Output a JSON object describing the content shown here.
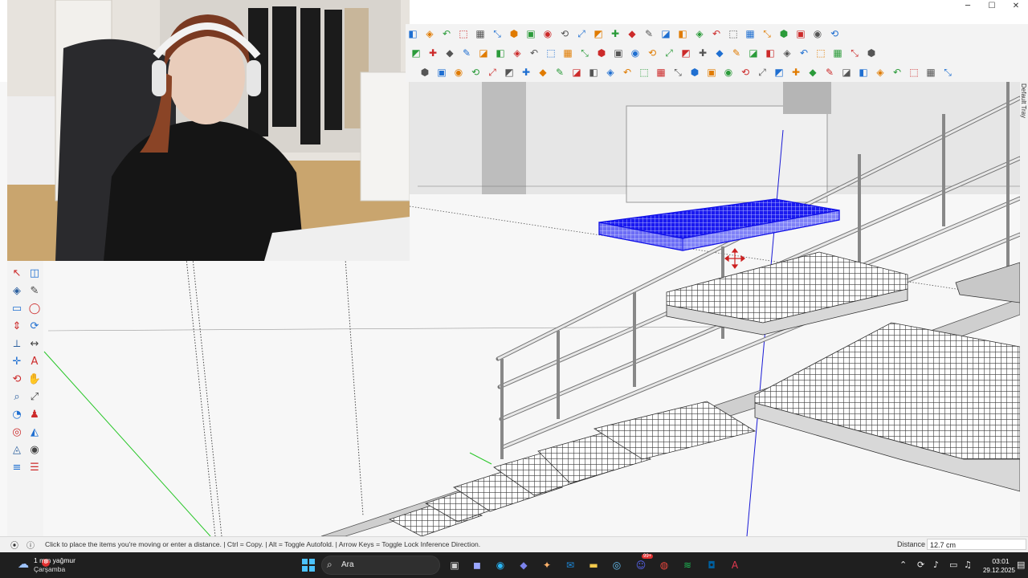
{
  "window": {
    "controls": [
      {
        "name": "minimize-button",
        "glyph": "─"
      },
      {
        "name": "maximize-button",
        "glyph": "☐"
      },
      {
        "name": "close-button",
        "glyph": "✕"
      }
    ]
  },
  "toolbar_rows": [
    {
      "name": "toolbar-row-views",
      "icons": [
        "walk-icon",
        "styles-icon",
        "orbit-icon",
        "new-icon",
        "user-icon",
        "xray-icon",
        "section-icon",
        "back-edges-icon",
        "wireframe-icon",
        "hidden-line-icon",
        "shaded-icon",
        "textured-icon",
        "monochrome-icon",
        "iso-icon",
        "top-view-icon",
        "front-view-icon",
        "right-view-icon",
        "back-view-icon",
        "left-view-icon",
        "camera-icon",
        "layers-icon",
        "shadow-icon",
        "fog-icon",
        "page-icon",
        "cube-icon",
        "house-icon"
      ]
    },
    {
      "name": "toolbar-row-tools",
      "icons": [
        "warning-icon",
        "rotate-icon",
        "extension-icon",
        "gear-icon",
        "move-icon",
        "bucket-icon",
        "undo-icon",
        "component-icon",
        "solid-icon",
        "group-icon",
        "paint-icon",
        "explode-icon",
        "array-icon",
        "grid-icon",
        "table-icon",
        "panel-icon",
        "box-icon",
        "wall-icon",
        "hatch-icon",
        "snap-icon",
        "circle-dash-icon",
        "scale-icon",
        "split-icon",
        "fold-icon",
        "stretch-icon",
        "trim-icon",
        "flip-icon",
        "mirror-icon"
      ]
    },
    {
      "name": "toolbar-row-curves",
      "icons": [
        "bezier-icon",
        "spline-icon",
        "pen-icon",
        "curve-icon",
        "freehand-icon",
        "arc-icon",
        "rect-icon",
        "polygon-icon",
        "circle-icon",
        "bend-icon",
        "zigzag-icon",
        "offset-icon",
        "fillet-icon",
        "chamfer-icon",
        "weld-icon",
        "node-icon",
        "edge-icon",
        "wrench-icon",
        "ellipse-icon",
        "cone-icon",
        "align-icon",
        "distribute-icon",
        "stack-icon",
        "copy-icon",
        "array2-icon",
        "path-icon",
        "loft-icon",
        "sweep-icon",
        "extrude-icon",
        "join-icon",
        "cut-icon",
        "project-icon"
      ]
    }
  ],
  "toolbar_colors": {
    "blue": "#1f6fd1",
    "orange": "#e07b00",
    "green": "#2b9b3a",
    "red": "#cc2a2a",
    "gray": "#555555"
  },
  "left_tools": [
    "select-icon",
    "eraser-icon",
    "paint-bucket-icon",
    "pencil-icon",
    "rectangle-icon",
    "circle-icon",
    "push-pull-icon",
    "follow-me-icon",
    "tape-measure-icon",
    "dimension-icon",
    "axes-icon",
    "text-icon",
    "orbit-icon",
    "pan-icon",
    "zoom-icon",
    "zoom-extents-icon",
    "look-around-icon",
    "walk-icon",
    "position-camera-icon",
    "section-plane-icon",
    "sandbox-icon",
    "stamp-icon",
    "layers-icon",
    "outliner-icon"
  ],
  "tray": {
    "label": "Default Tray"
  },
  "status": {
    "message": "Click to place the items you're moving or enter a distance.  |  Ctrl = Copy.  |  Alt = Toggle Autofold.  |  Arrow Keys = Toggle Lock Inference Direction.",
    "distance_label": "Distance",
    "distance_value": "12.7 cm"
  },
  "taskbar": {
    "weather_temp": "1 mm yağmur",
    "weather_day": "Çarşamba",
    "weather_badge": "3",
    "search_placeholder": "Ara",
    "apps": [
      {
        "name": "task-view-icon",
        "glyph": "▣",
        "color": "#cccccc"
      },
      {
        "name": "store-icon",
        "glyph": "◼",
        "color": "#9aa7ff"
      },
      {
        "name": "edge-icon",
        "glyph": "◉",
        "color": "#29b6f6"
      },
      {
        "name": "teams-icon",
        "glyph": "◆",
        "color": "#7b83eb"
      },
      {
        "name": "copilot-icon",
        "glyph": "✦",
        "color": "#ffb36b"
      },
      {
        "name": "outlook-icon",
        "glyph": "✉",
        "color": "#1c8adb"
      },
      {
        "name": "file-explorer-icon",
        "glyph": "▬",
        "color": "#f2c94c"
      },
      {
        "name": "steam-icon",
        "glyph": "◎",
        "color": "#66c0f4"
      },
      {
        "name": "discord-icon",
        "glyph": "☺",
        "color": "#5865f2"
      },
      {
        "name": "chrome-icon",
        "glyph": "◍",
        "color": "#e8453c"
      },
      {
        "name": "spotify-icon",
        "glyph": "≋",
        "color": "#1db954"
      },
      {
        "name": "sketchup-icon",
        "glyph": "◘",
        "color": "#005f9e"
      },
      {
        "name": "app-a-icon",
        "glyph": "A",
        "color": "#e53950"
      }
    ],
    "discord_badge": "99+",
    "clock_time": "03:01",
    "clock_date": "29.12.2025"
  },
  "scene": {
    "selected_color": "#1010e6",
    "edge_color": "#333333",
    "green_axis": "#28c628",
    "blue_axis": "#1a1ad6"
  }
}
